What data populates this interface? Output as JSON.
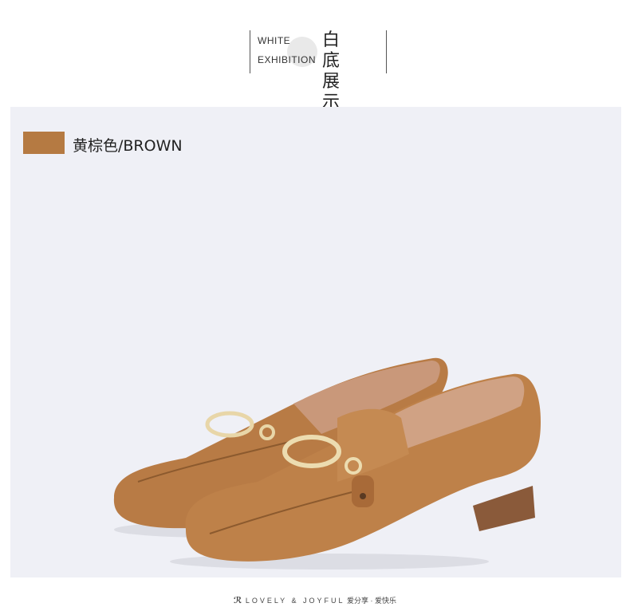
{
  "header": {
    "en_line1": "WHITE",
    "en_line2": "EXHIBITION",
    "zh_line1": "白 底",
    "zh_line2": "展 示"
  },
  "product": {
    "color_label": "黄棕色/BROWN",
    "swatch_color": "#b57a42",
    "panel_bg": "#eff0f6",
    "image_name": "brown-loafers-image"
  },
  "footer": {
    "brand": "LOVELY & JOYFUL",
    "tagline": "爱分享 · 爱快乐"
  }
}
